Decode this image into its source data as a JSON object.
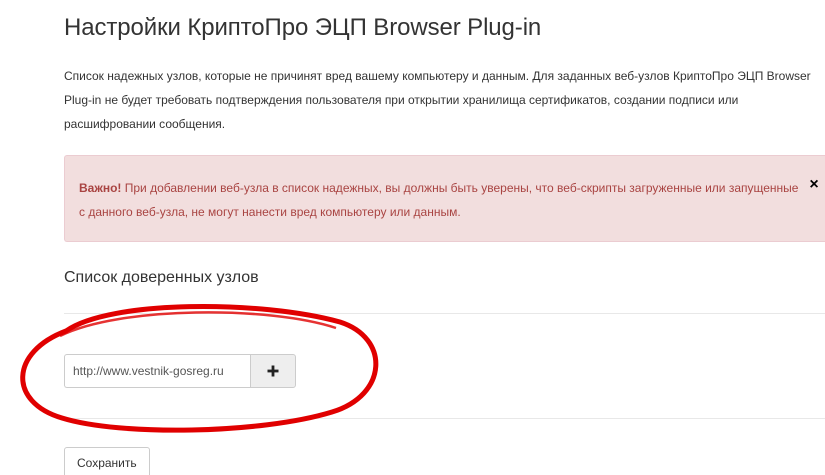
{
  "page": {
    "title": "Настройки КриптоПро ЭЦП Browser Plug-in",
    "intro": "Список надежных узлов, которые не причинят вред вашему компьютеру и данным. Для заданных веб-узлов КриптоПро ЭЦП Browser Plug-in не будет требовать подтверждения пользователя при открытии хранилища сертификатов, создании подписи или расшифровании сообщения."
  },
  "alert": {
    "strong": "Важно!",
    "text": " При добавлении веб-узла в список надежных, вы должны быть уверены, что веб-скрипты загруженные или запущенные с данного веб-узла, не могут нанести вред компьютеру или данным.",
    "close": "×",
    "bg_color": "#f2dede",
    "text_color": "#a94442"
  },
  "trusted": {
    "heading": "Список доверенных узлов",
    "input_value": "http://www.vestnik-gosreg.ru",
    "add_icon": "plus-icon"
  },
  "actions": {
    "save_label": "Сохранить"
  },
  "annotation": {
    "shape": "red-ellipse",
    "color": "#e00000"
  }
}
